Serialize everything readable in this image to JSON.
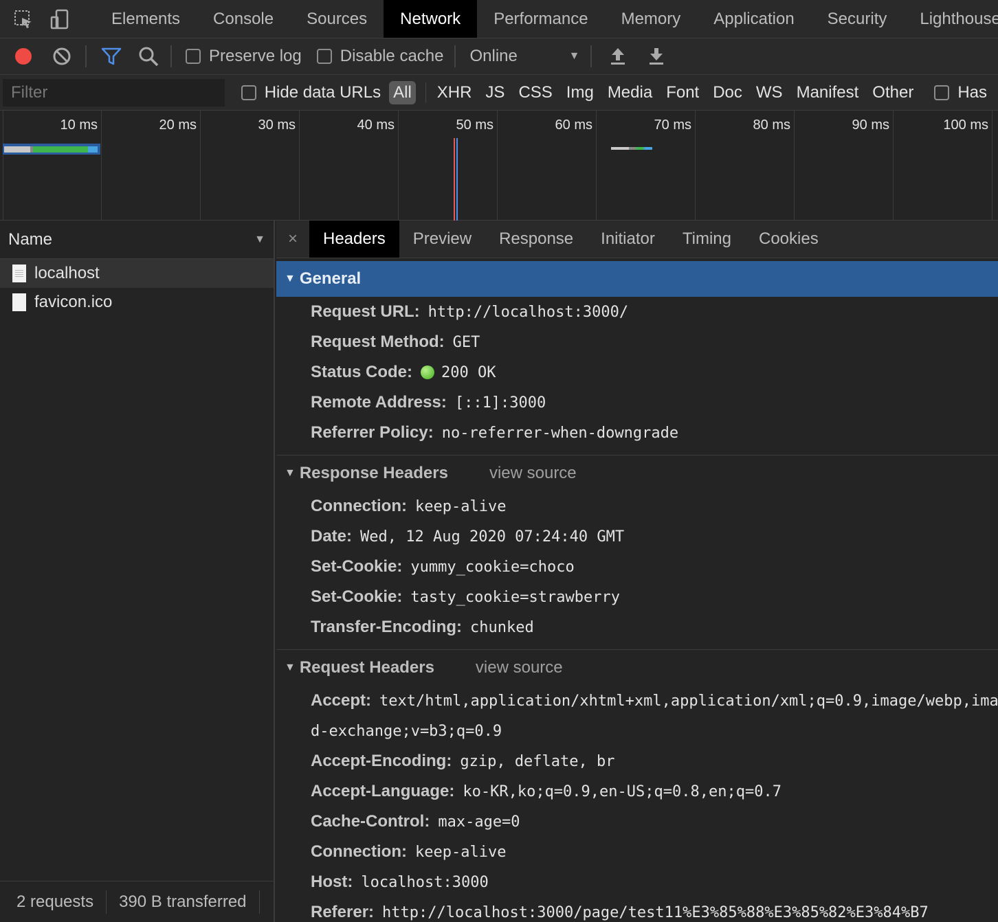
{
  "panels": {
    "tabs": [
      "Elements",
      "Console",
      "Sources",
      "Network",
      "Performance",
      "Memory",
      "Application",
      "Security",
      "Lighthouse"
    ],
    "active": "Network"
  },
  "toolbar": {
    "preserve_log": "Preserve log",
    "disable_cache": "Disable cache",
    "throttle": "Online"
  },
  "filterbar": {
    "placeholder": "Filter",
    "hide_data_urls": "Hide data URLs",
    "types": [
      "All",
      "XHR",
      "JS",
      "CSS",
      "Img",
      "Media",
      "Font",
      "Doc",
      "WS",
      "Manifest",
      "Other"
    ],
    "has_label": "Has"
  },
  "overview": {
    "ticks": [
      "10 ms",
      "20 ms",
      "30 ms",
      "40 ms",
      "50 ms",
      "60 ms",
      "70 ms",
      "80 ms",
      "90 ms",
      "100 ms"
    ]
  },
  "requests": {
    "header": "Name",
    "items": [
      "localhost",
      "favicon.ico"
    ],
    "summary_count": "2 requests",
    "summary_size": "390 B transferred"
  },
  "details": {
    "close": "×",
    "tabs": [
      "Headers",
      "Preview",
      "Response",
      "Initiator",
      "Timing",
      "Cookies"
    ],
    "active": "Headers",
    "view_source": "view source",
    "general": {
      "title": "General",
      "rows": [
        {
          "k": "Request URL:",
          "v": "http://localhost:3000/"
        },
        {
          "k": "Request Method:",
          "v": "GET"
        },
        {
          "k": "Status Code:",
          "v": "200 OK"
        },
        {
          "k": "Remote Address:",
          "v": "[::1]:3000"
        },
        {
          "k": "Referrer Policy:",
          "v": "no-referrer-when-downgrade"
        }
      ]
    },
    "response": {
      "title": "Response Headers",
      "rows": [
        {
          "k": "Connection:",
          "v": "keep-alive"
        },
        {
          "k": "Date:",
          "v": "Wed, 12 Aug 2020 07:24:40 GMT"
        },
        {
          "k": "Set-Cookie:",
          "v": "yummy_cookie=choco"
        },
        {
          "k": "Set-Cookie:",
          "v": "tasty_cookie=strawberry"
        },
        {
          "k": "Transfer-Encoding:",
          "v": "chunked"
        }
      ]
    },
    "request": {
      "title": "Request Headers",
      "accept_k": "Accept:",
      "accept_v": "text/html,application/xhtml+xml,application/xml;q=0.9,image/webp,ima",
      "accept_cont": "d-exchange;v=b3;q=0.9",
      "rows": [
        {
          "k": "Accept-Encoding:",
          "v": "gzip, deflate, br"
        },
        {
          "k": "Accept-Language:",
          "v": "ko-KR,ko;q=0.9,en-US;q=0.8,en;q=0.7"
        },
        {
          "k": "Cache-Control:",
          "v": "max-age=0"
        },
        {
          "k": "Connection:",
          "v": "keep-alive"
        },
        {
          "k": "Host:",
          "v": "localhost:3000"
        },
        {
          "k": "Referer:",
          "v": "http://localhost:3000/page/test11%E3%85%88%E3%85%82%E3%84%B7"
        }
      ]
    }
  }
}
